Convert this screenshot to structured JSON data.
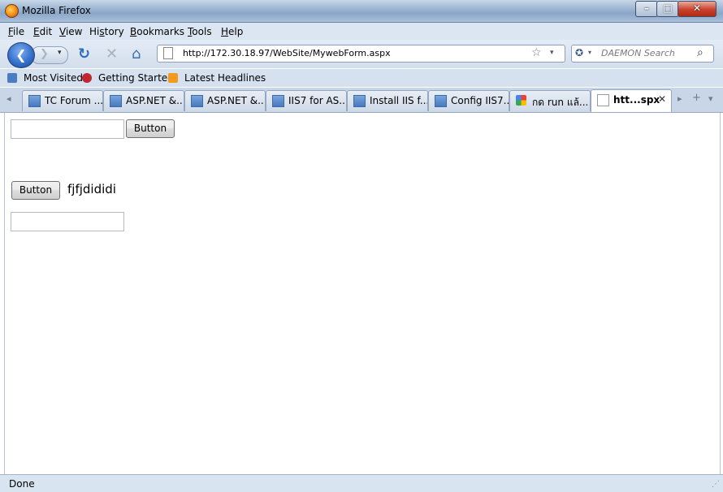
{
  "window": {
    "title": "Mozilla Firefox",
    "min_glyph": "–",
    "max_glyph": "□",
    "close_glyph": "✕"
  },
  "menu": {
    "items": [
      {
        "label": "File",
        "key": "F",
        "rest": "ile"
      },
      {
        "label": "Edit",
        "key": "E",
        "rest": "dit"
      },
      {
        "label": "View",
        "key": "V",
        "rest": "iew"
      },
      {
        "label": "History",
        "pre": "Hi",
        "key": "s",
        "rest": "tory"
      },
      {
        "label": "Bookmarks",
        "key": "B",
        "rest": "ookmarks"
      },
      {
        "label": "Tools",
        "key": "T",
        "rest": "ools"
      },
      {
        "label": "Help",
        "key": "H",
        "rest": "elp"
      }
    ]
  },
  "nav": {
    "back_icon": "back-arrow-icon",
    "back_glyph": "❮",
    "forward_glyph": "❯",
    "dropdown_glyph": "▾",
    "reload_glyph": "↻",
    "stop_glyph": "✕",
    "home_glyph": "⌂",
    "url": "http://172.30.18.97/WebSite/MywebForm.aspx",
    "star_glyph": "☆",
    "search_placeholder": "DAEMON Search",
    "search_engine_glyph": "✪",
    "search_go_glyph": "⌕"
  },
  "bookmarks": {
    "items": [
      "Most Visited",
      "Getting Started",
      "Latest Headlines"
    ]
  },
  "tabs": {
    "items": [
      {
        "label": "TC Forum ...",
        "icon": "site-icon"
      },
      {
        "label": "ASP.NET &...",
        "icon": "site-icon"
      },
      {
        "label": "ASP.NET &...",
        "icon": "site-icon"
      },
      {
        "label": "IIS7 for AS...",
        "icon": "site-icon"
      },
      {
        "label": "Install IIS f...",
        "icon": "site-icon"
      },
      {
        "label": "Config IIS7...",
        "icon": "site-icon"
      },
      {
        "label": "กด run แล้...",
        "icon": "google-icon"
      },
      {
        "label": "htt...spx",
        "icon": "page-icon",
        "active": true
      }
    ],
    "close_glyph": "✕",
    "scroll_left_glyph": "◂",
    "scroll_right_glyph": "▸",
    "new_tab_glyph": "+",
    "list_glyph": "▾"
  },
  "page": {
    "button1_label": "Button",
    "button2_label": "Button",
    "label_text": "fjfjdididi",
    "textbox1_value": "",
    "textbox2_value": ""
  },
  "status": {
    "text": "Done",
    "grip_glyph": "⋰"
  }
}
